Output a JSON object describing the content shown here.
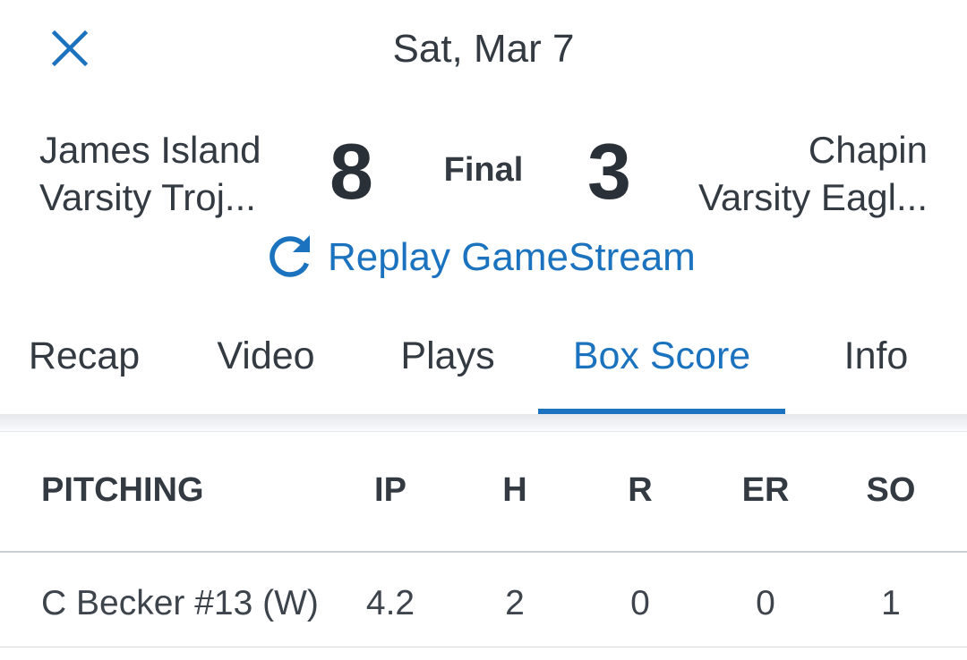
{
  "header": {
    "close_icon": "close-icon",
    "date": "Sat, Mar 7"
  },
  "game": {
    "home_team": {
      "line1": "James Island",
      "line2": "Varsity Troj...",
      "score": "8"
    },
    "away_team": {
      "line1": "Chapin",
      "line2": "Varsity Eagl...",
      "score": "3"
    },
    "status": "Final",
    "replay_label": "Replay GameStream",
    "replay_icon": "refresh-icon"
  },
  "tabs": [
    {
      "label": "Recap",
      "active": false
    },
    {
      "label": "Video",
      "active": false
    },
    {
      "label": "Plays",
      "active": false
    },
    {
      "label": "Box Score",
      "active": true
    },
    {
      "label": "Info",
      "active": false
    }
  ],
  "pitching": {
    "columns": [
      "PITCHING",
      "IP",
      "H",
      "R",
      "ER",
      "SO"
    ],
    "rows": [
      [
        "C Becker #13 (W)",
        "4.2",
        "2",
        "0",
        "0",
        "1"
      ]
    ]
  },
  "colors": {
    "accent": "#1b72be",
    "text": "#333a42"
  }
}
